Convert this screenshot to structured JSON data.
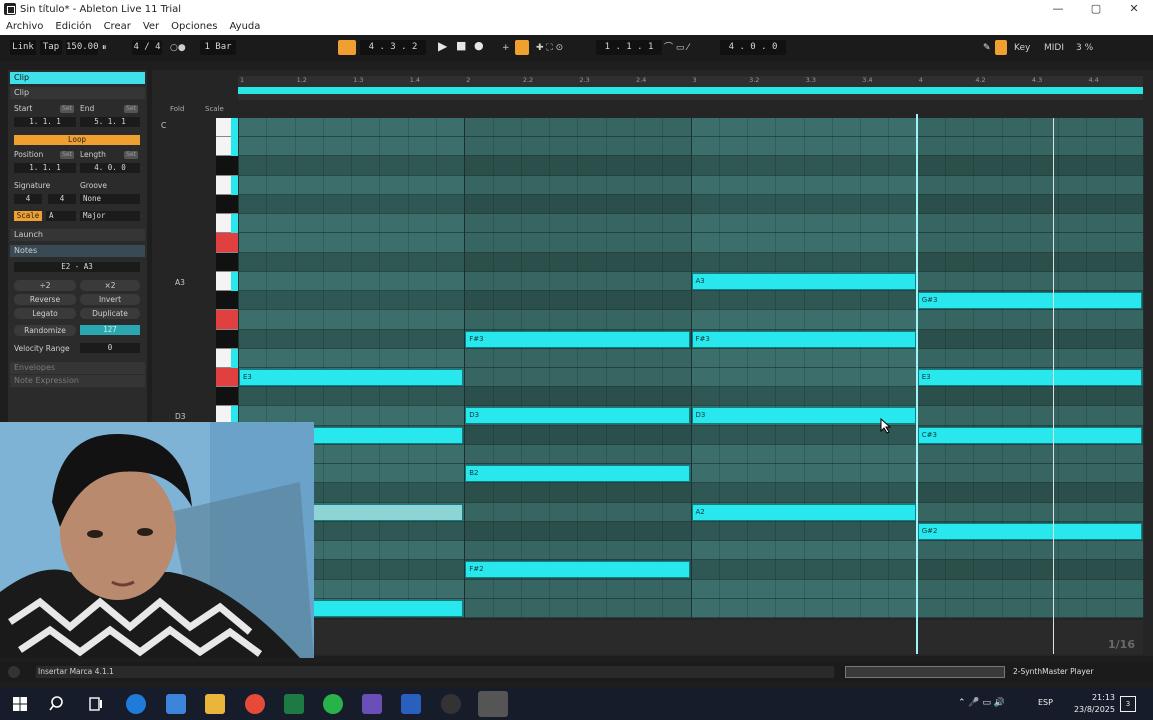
{
  "window": {
    "title": "Sin título* - Ableton Live 11 Trial",
    "minimize": "—",
    "maximize": "▢",
    "close": "✕"
  },
  "menu": [
    "Archivo",
    "Edición",
    "Crear",
    "Ver",
    "Opciones",
    "Ayuda"
  ],
  "transport": {
    "link": "Link",
    "tap": "Tap",
    "tempo": "150.00",
    "signature": "4 / 4",
    "quantize": "1 Bar",
    "arrangement_position": "4 .   3 .   2",
    "loop_start": "1 .   1 .   1",
    "loop_length": "4 .   0 .   0",
    "key_label": "Key",
    "midi_label": "MIDI",
    "cpu": "3 %"
  },
  "clip_panel": {
    "clip_header": "Clip",
    "clip_section": "Clip",
    "start_label": "Start",
    "end_label": "End",
    "set_label": "Set",
    "start_value": "1.   1.   1",
    "end_value": "5.   1.   1",
    "loop_button": "Loop",
    "position_label": "Position",
    "length_label": "Length",
    "position_value": "1.   1.   1",
    "length_value": "4.   0.   0",
    "signature_label": "Signature",
    "groove_label": "Groove",
    "sig_num": "4",
    "sig_den": "4",
    "groove_value": "None",
    "scale_button": "Scale",
    "scale_root": "A",
    "scale_mode": "Major",
    "launch_section": "Launch",
    "notes_section": "Notes",
    "note_range": "E2 - A3",
    "div2": "÷2",
    "mul2": "×2",
    "reverse": "Reverse",
    "invert": "Invert",
    "legato": "Legato",
    "duplicate": "Duplicate",
    "randomize": "Randomize",
    "randomize_amount": "127",
    "velocity_range_label": "Velocity Range",
    "velocity_range_value": "0",
    "envelopes_section": "Envelopes",
    "note_expression_section": "Note Expression"
  },
  "editor": {
    "fold": "Fold",
    "scale": "Scale",
    "ruler": [
      "1",
      "1.2",
      "1.3",
      "1.4",
      "2",
      "2.2",
      "2.3",
      "2.4",
      "3",
      "3.2",
      "3.3",
      "3.4",
      "4",
      "4.2",
      "4.3",
      "4.4"
    ],
    "octave_labels": [
      "C",
      "A3",
      "D3"
    ],
    "grid_readout": "1/16",
    "notes": [
      {
        "label": "A3",
        "row": 8,
        "start": 2.0,
        "end": 3.0
      },
      {
        "label": "G#3",
        "row": 9,
        "start": 3.0,
        "end": 4.0
      },
      {
        "label": "F#3",
        "row": 11,
        "start": 1.0,
        "end": 2.0
      },
      {
        "label": "F#3",
        "row": 11,
        "start": 2.0,
        "end": 3.0
      },
      {
        "label": "E3",
        "row": 13,
        "start": 0.0,
        "end": 1.0
      },
      {
        "label": "E3",
        "row": 13,
        "start": 3.0,
        "end": 4.0
      },
      {
        "label": "D3",
        "row": 15,
        "start": 1.0,
        "end": 2.0
      },
      {
        "label": "D3",
        "row": 15,
        "start": 2.0,
        "end": 3.0
      },
      {
        "label": "",
        "row": 16,
        "start": 0.0,
        "end": 1.0
      },
      {
        "label": "C#3",
        "row": 16,
        "start": 3.0,
        "end": 4.0
      },
      {
        "label": "B2",
        "row": 18,
        "start": 1.0,
        "end": 2.0
      },
      {
        "label": "",
        "row": 20,
        "start": 0.0,
        "end": 1.0,
        "dim": true
      },
      {
        "label": "A2",
        "row": 20,
        "start": 2.0,
        "end": 3.0
      },
      {
        "label": "G#2",
        "row": 21,
        "start": 3.0,
        "end": 4.0
      },
      {
        "label": "F#2",
        "row": 23,
        "start": 1.0,
        "end": 2.0
      },
      {
        "label": "",
        "row": 25,
        "start": 0.0,
        "end": 1.0
      }
    ]
  },
  "status": {
    "message": "Insertar Marca 4.1.1",
    "track": "2-SynthMaster Player"
  },
  "taskbar": {
    "language": "ESP",
    "time": "21:13",
    "date": "23/8/2025",
    "notification_count": "3"
  },
  "colors": {
    "note": "#28e8ee",
    "accent": "#f0a030",
    "lane_light": "#3c6f6b",
    "lane_dark": "#2f5753"
  }
}
